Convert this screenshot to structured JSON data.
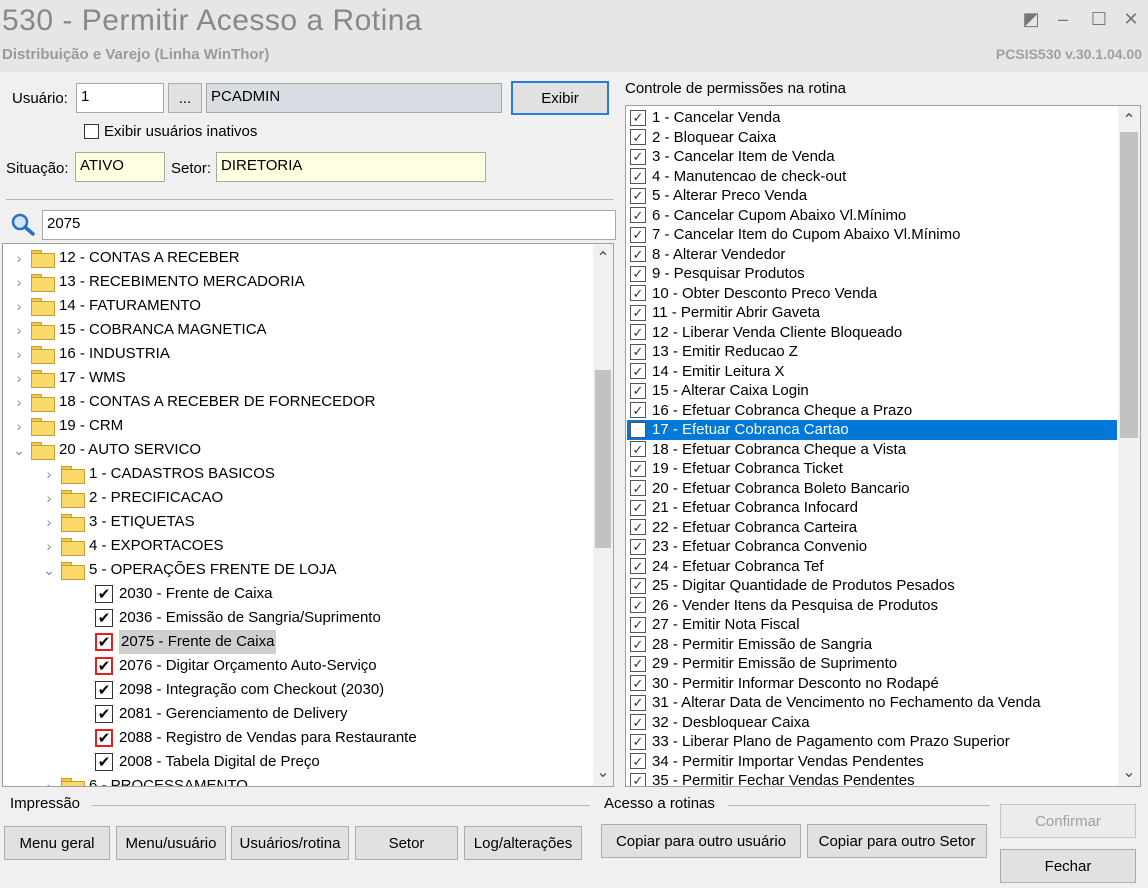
{
  "window": {
    "title": "530 - Permitir Acesso a Rotina",
    "subtitle": "Distribuição e Varejo (Linha WinThor)",
    "version": "PCSIS530  v.30.1.04.00"
  },
  "user": {
    "label": "Usuário:",
    "code": "1",
    "ellipsis": "...",
    "name": "PCADMIN",
    "show_button": "Exibir",
    "inactive_label": "Exibir usuários inativos",
    "situation_label": "Situação:",
    "situation": "ATIVO",
    "sector_label": "Setor:",
    "sector": "DIRETORIA"
  },
  "search": {
    "value": "2075"
  },
  "tree": {
    "nodes": [
      {
        "label": "12 - CONTAS A RECEBER"
      },
      {
        "label": "13 - RECEBIMENTO MERCADORIA"
      },
      {
        "label": "14 - FATURAMENTO"
      },
      {
        "label": "15 - COBRANCA MAGNETICA"
      },
      {
        "label": "16 - INDUSTRIA"
      },
      {
        "label": "17 - WMS"
      },
      {
        "label": "18 - CONTAS A RECEBER DE FORNECEDOR"
      },
      {
        "label": "19 - CRM"
      },
      {
        "label": "20 - AUTO SERVICO"
      },
      {
        "label": "1 - CADASTROS BASICOS"
      },
      {
        "label": "2 - PRECIFICACAO"
      },
      {
        "label": "3 - ETIQUETAS"
      },
      {
        "label": "4 - EXPORTACOES"
      },
      {
        "label": "5 - OPERAÇÕES FRENTE DE LOJA"
      },
      {
        "label": "2030 - Frente de Caixa"
      },
      {
        "label": "2036 - Emissão de Sangria/Suprimento"
      },
      {
        "label": "2075 - Frente de Caixa"
      },
      {
        "label": "2076 - Digitar Orçamento Auto-Serviço"
      },
      {
        "label": "2098 - Integração com Checkout (2030)"
      },
      {
        "label": "2081 - Gerenciamento de Delivery"
      },
      {
        "label": "2088 - Registro de Vendas para Restaurante"
      },
      {
        "label": "2008 - Tabela Digital de Preço"
      },
      {
        "label": "6 - PROCESSAMENTO"
      }
    ],
    "check_mark": "✔"
  },
  "permissions": {
    "title": "Controle de permissões na rotina",
    "check_mark": "✓",
    "items": [
      {
        "label": "1 - Cancelar Venda"
      },
      {
        "label": "2 - Bloquear Caixa"
      },
      {
        "label": "3 - Cancelar Item de Venda"
      },
      {
        "label": "4 - Manutencao de check-out"
      },
      {
        "label": "5 - Alterar Preco Venda"
      },
      {
        "label": "6 - Cancelar Cupom Abaixo Vl.Mínimo"
      },
      {
        "label": "7 - Cancelar Item do Cupom Abaixo Vl.Mínimo"
      },
      {
        "label": "8 - Alterar Vendedor"
      },
      {
        "label": "9 - Pesquisar Produtos"
      },
      {
        "label": "10 - Obter Desconto Preco Venda"
      },
      {
        "label": "11 - Permitir Abrir Gaveta"
      },
      {
        "label": "12 - Liberar Venda Cliente Bloqueado"
      },
      {
        "label": "13 - Emitir Reducao Z"
      },
      {
        "label": "14 - Emitir Leitura X"
      },
      {
        "label": "15 - Alterar Caixa Login"
      },
      {
        "label": "16 - Efetuar Cobranca Cheque a Prazo"
      },
      {
        "label": "17 - Efetuar Cobranca Cartao"
      },
      {
        "label": "18 - Efetuar Cobranca Cheque a Vista"
      },
      {
        "label": "19 - Efetuar Cobranca Ticket"
      },
      {
        "label": "20 - Efetuar Cobranca Boleto Bancario"
      },
      {
        "label": "21 - Efetuar Cobranca Infocard"
      },
      {
        "label": "22 - Efetuar Cobranca Carteira"
      },
      {
        "label": "23 - Efetuar Cobranca Convenio"
      },
      {
        "label": "24 - Efetuar Cobranca Tef"
      },
      {
        "label": "25 - Digitar Quantidade de Produtos Pesados"
      },
      {
        "label": "26 - Vender Itens da Pesquisa de Produtos"
      },
      {
        "label": "27 - Emitir Nota Fiscal"
      },
      {
        "label": "28 - Permitir Emissão de Sangria"
      },
      {
        "label": "29 - Permitir Emissão de Suprimento"
      },
      {
        "label": "30 - Permitir Informar Desconto no Rodapé"
      },
      {
        "label": "31 - Alterar Data de Vencimento no Fechamento da Venda"
      },
      {
        "label": "32 - Desbloquear Caixa"
      },
      {
        "label": "33 - Liberar Plano de Pagamento com Prazo Superior"
      },
      {
        "label": "34 - Permitir Importar Vendas Pendentes"
      },
      {
        "label": "35 - Permitir Fechar Vendas Pendentes"
      }
    ]
  },
  "footer": {
    "print_group": "Impressão",
    "print_buttons": [
      "Menu geral",
      "Menu/usuário",
      "Usuários/rotina",
      "Setor",
      "Log/alterações"
    ],
    "access_group": "Acesso a rotinas",
    "copy_user": "Copiar para outro usuário",
    "copy_sector": "Copiar para outro Setor",
    "confirm": "Confirmar",
    "close": "Fechar"
  },
  "scroll": {
    "arrow_up": "⌃",
    "arrow_down": "⌄"
  },
  "icons": {
    "minimize": "–",
    "maximize": "☐",
    "close": "✕",
    "restore": "◩",
    "chevron_right": "›",
    "chevron_down": "⌄"
  }
}
